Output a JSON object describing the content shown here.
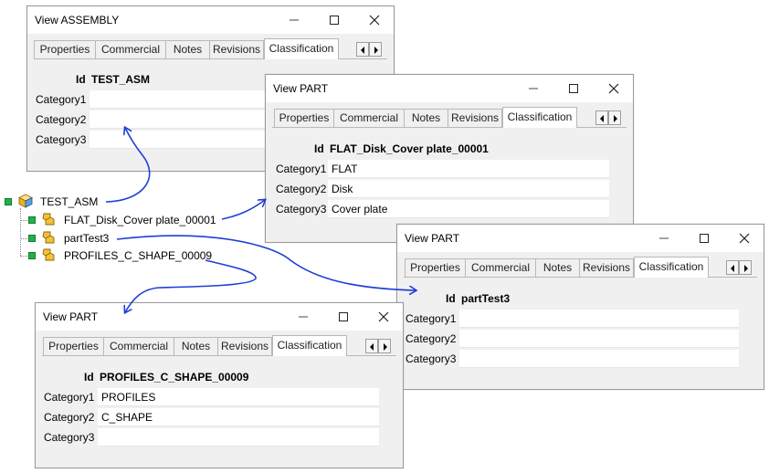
{
  "tree": {
    "root_label": "TEST_ASM",
    "children": [
      {
        "label": "FLAT_Disk_Cover plate_00001"
      },
      {
        "label": "partTest3"
      },
      {
        "label": "PROFILES_C_SHAPE_00009"
      }
    ]
  },
  "tabs": [
    "Properties",
    "Commercial",
    "Notes",
    "Revisions",
    "Classification"
  ],
  "field_labels": {
    "id": "Id",
    "cat1": "Category1",
    "cat2": "Category2",
    "cat3": "Category3"
  },
  "windows": {
    "assembly": {
      "title": "View ASSEMBLY",
      "id": "TEST_ASM",
      "category1": "",
      "category2": "",
      "category3": ""
    },
    "part_flat": {
      "title": "View PART",
      "id": "FLAT_Disk_Cover plate_00001",
      "category1": "FLAT",
      "category2": "Disk",
      "category3": "Cover plate"
    },
    "part_test3": {
      "title": "View PART",
      "id": "partTest3",
      "category1": "",
      "category2": "",
      "category3": ""
    },
    "part_profiles": {
      "title": "View PART",
      "id": "PROFILES_C_SHAPE_00009",
      "category1": "PROFILES",
      "category2": "C_SHAPE",
      "category3": ""
    }
  },
  "colors": {
    "arrow": "#1f3fd6",
    "tree_square": "#22b14c",
    "cube_icon": "#f0b020"
  },
  "icons": [
    "minimize-icon",
    "maximize-icon",
    "close-icon",
    "scroll-left-icon",
    "scroll-right-icon",
    "assembly-cube-icon",
    "part-icon"
  ]
}
